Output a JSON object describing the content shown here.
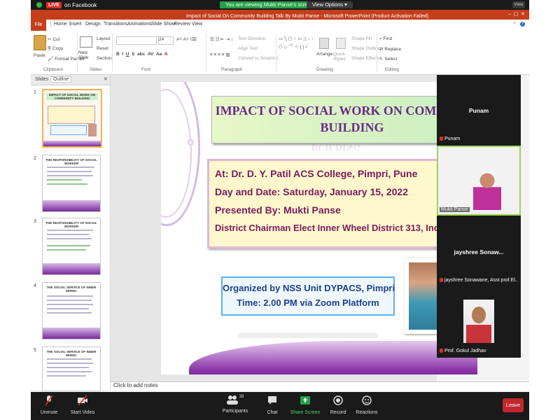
{
  "zoom": {
    "live_badge": "LIVE",
    "facebook_label": "on Facebook",
    "viewing_banner": "You are viewing Mukti Panse's screen",
    "view_options": "View Options",
    "view_label": "View"
  },
  "ppt": {
    "title": "Impact of Social On Community Building Talk By Mukti Panse  -  Microsoft PowerPoint (Product Activation Failed)",
    "tabs": [
      "File",
      "Home",
      "Insert",
      "Design",
      "Transitions",
      "Animations",
      "Slide Show",
      "Review",
      "View"
    ],
    "ribbon": {
      "clipboard": {
        "label": "Clipboard",
        "paste": "Paste",
        "cut": "Cut",
        "copy": "Copy",
        "format_painter": "Format Painter"
      },
      "slides": {
        "label": "Slides",
        "new_slide": "New Slide",
        "layout": "Layout",
        "reset": "Reset",
        "section": "Section"
      },
      "font": {
        "label": "Font",
        "size": "24"
      },
      "paragraph": {
        "label": "Paragraph",
        "text_direction": "Text Direction",
        "align_text": "Align Text",
        "smartart": "Convert to SmartArt"
      },
      "drawing": {
        "label": "Drawing",
        "arrange": "Arrange",
        "quick_styles": "Quick Styles",
        "shape_fill": "Shape Fill",
        "shape_outline": "Shape Outline",
        "shape_effects": "Shape Effects"
      },
      "editing": {
        "label": "Editing",
        "find": "Find",
        "replace": "Replace",
        "select": "Select"
      }
    },
    "panel_tabs": [
      "Slides",
      "Outline"
    ],
    "thumbnails": [
      {
        "num": "1",
        "title": "IMPACT OF SOCIAL WORK ON COMMUNITY BUILDING"
      },
      {
        "num": "2",
        "title": "THE RESPONSIBILITY OF SOCIAL WORKER"
      },
      {
        "num": "3",
        "title": "THE RESPONSIBILITY OF SOCIAL WORKER"
      },
      {
        "num": "4",
        "title": "THE SOCIAL SERVICE OF INNER WHEEL"
      },
      {
        "num": "5",
        "title": "THE SOCIAL SERVICE OF INNER WHEEL"
      }
    ],
    "notes_placeholder": "Click to add notes",
    "slide": {
      "title_line1": "IMPACT OF SOCIAL WORK ON COMMUNITY",
      "title_line2": "BUILDING",
      "title_ghost": "BUILDING",
      "info_line1": "At: Dr. D. Y. Patil ACS College, Pimpri, Pune",
      "info_line2": "Day and Date: Saturday,  January 15, 2022",
      "info_line3": "Presented By: Mukti Panse",
      "info_line4": "District Chairman Elect Inner Wheel District 313, India",
      "org_line1": "Organized by NSS Unit DYPACS, Pimpri",
      "org_line2": "Time: 2.00 PM via Zoom Platform"
    }
  },
  "participants": [
    {
      "big_name": "Punam",
      "label": "Punam",
      "has_video": false
    },
    {
      "big_name": "",
      "label": "Mukti Panse",
      "has_video": true
    },
    {
      "big_name": "jayshree  Sonaw...",
      "label": "jayshree Sonawane,  Asst prof.El..",
      "has_video": false
    },
    {
      "big_name": "",
      "label": "Prof. Gokul Jadhav",
      "has_video": true
    }
  ],
  "controls": {
    "unmute": "Unmute",
    "start_video": "Start Video",
    "participants": "Participants",
    "participant_count": "38",
    "chat": "Chat",
    "share_screen": "Share Screen",
    "record": "Record",
    "reactions": "Reactions",
    "leave": "Leave"
  },
  "colors": {
    "ppt_accent": "#c43e1c",
    "zoom_green": "#24a148",
    "leave_red": "#c0262e",
    "slide_purple": "#7a2a9c",
    "title_text": "#6a2a8c",
    "info_text": "#7a1a5e",
    "org_text": "#1b3f8c"
  }
}
